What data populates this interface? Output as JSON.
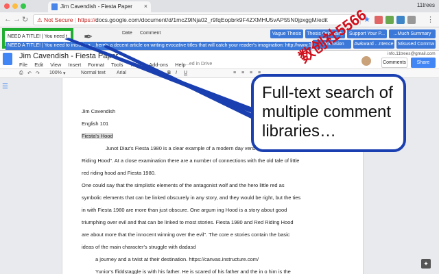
{
  "browser": {
    "tab_title": "Jim Cavendish - Fiesta Paper",
    "profile_name": "11trees",
    "security_label": "Not Secure",
    "url_scheme": "https://",
    "url_rest": "docs.google.com/document/d/1mcZ9lNja02_r9fqEopbrk9F4ZXMHU5vAP55N0jpxggM/edit"
  },
  "extension": {
    "selected_comment_preview": "NEED A TITLE! | You need t",
    "col_date": "Date",
    "col_comment": "Comment",
    "suggestion_text": "NEED A TITLE! | You need to include a ...here's a decent article on writing evocative titles that will catch your reader's imagination: http://www.11trees.com/",
    "categories": [
      "Vague Thesis",
      "Thesis Originality",
      "Support Your P...",
      "...Much Summary",
      "...onclusion",
      "Awkward ...ntence",
      "Misused Comma"
    ]
  },
  "docs": {
    "doc_title": "Jim Cavendish - Fiesta Paper",
    "menu": [
      "File",
      "Edit",
      "View",
      "Insert",
      "Format",
      "Tools",
      "Table",
      "Add-ons",
      "Help"
    ],
    "saved_status": "...ed in Drive",
    "user_email": "info.11trees@gmail.com",
    "comments_label": "Comments",
    "share_label": "Share",
    "zoom": "100%",
    "style": "Normal text",
    "font": "Arial",
    "font_size": "11"
  },
  "document_lines": [
    "Jim Cavendish",
    "English 101",
    "Fiesta's Hood",
    "Junot Diaz's Fiesta 1980 is a clear example of a modern day version of the sto...",
    "Riding Hood\". At a close examination there are a number of connections with the old tale of little",
    "red riding hood and Fiesta 1980.",
    "One could say that the simplistic elements of the antagonist wolf and the hero little red as",
    "symbolic elements that can be linked obscurely in any story, and they would be right, but the ties",
    "in with Fiesta 1980 are more than just obscure. One argum ing Hood is a story about good",
    "triumphing over evil and that can be linked to most stories. Fiesta 1980 and Red Riding Hood",
    "are about more that the innocent winning over the evil\". The core e stories contain the basic",
    "ideas of the main character's struggle with dadasd",
    "a journey and a twist at their destination. https://canvas.instructure.com/",
    "Yunior's ffiddstaggle is with his father. He is scared of his father and the in o him is the",
    "car ride to the party. The party is his destination and if he can make it there before he throws up"
  ],
  "callout_text": "Full-text search of multiple comment libraries…",
  "watermark_text": "数创社5566",
  "colors": {
    "callout_border": "#1a3fb0",
    "selection_box": "#1fae2f",
    "category_button": "#3c78d8",
    "share_button": "#4285f4",
    "insecure_text": "#c5221f"
  },
  "icons": [
    "back-icon",
    "forward-icon",
    "reload-icon",
    "star-icon",
    "pen-nib-icon",
    "docs-logo-icon",
    "outline-icon",
    "explore-icon"
  ]
}
